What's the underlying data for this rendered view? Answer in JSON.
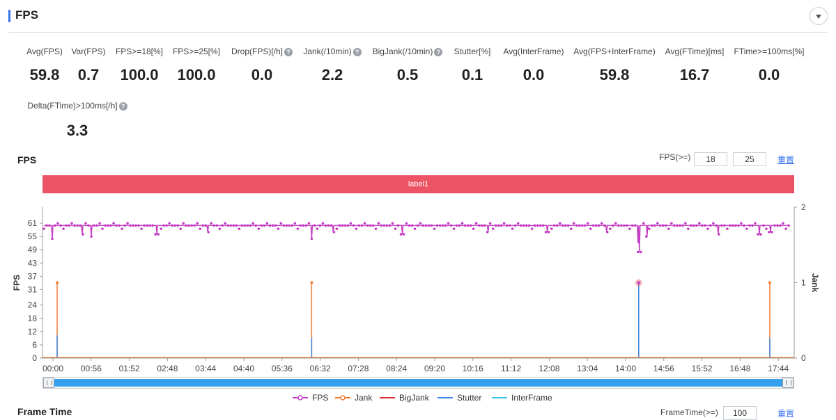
{
  "header": {
    "title": "FPS"
  },
  "metrics": [
    {
      "label": "Avg(FPS)",
      "value": "59.8",
      "help": false
    },
    {
      "label": "Var(FPS)",
      "value": "0.7",
      "help": false
    },
    {
      "label": "FPS>=18[%]",
      "value": "100.0",
      "help": false
    },
    {
      "label": "FPS>=25[%]",
      "value": "100.0",
      "help": false
    },
    {
      "label": "Drop(FPS)[/h]",
      "value": "0.0",
      "help": true
    },
    {
      "label": "Jank(/10min)",
      "value": "2.2",
      "help": true
    },
    {
      "label": "BigJank(/10min)",
      "value": "0.5",
      "help": true
    },
    {
      "label": "Stutter[%]",
      "value": "0.1",
      "help": false
    },
    {
      "label": "Avg(InterFrame)",
      "value": "0.0",
      "help": false
    },
    {
      "label": "Avg(FPS+InterFrame)",
      "value": "59.8",
      "help": false
    },
    {
      "label": "Avg(FTime)[ms]",
      "value": "16.7",
      "help": false
    },
    {
      "label": "FTime>=100ms[%]",
      "value": "0.0",
      "help": false
    },
    {
      "label": "Delta(FTime)>100ms[/h]",
      "value": "3.3",
      "help": true
    }
  ],
  "help_glyph": "?",
  "fps_section": {
    "title": "FPS",
    "threshold_label": "FPS(>=)",
    "threshold_low": "18",
    "threshold_high": "25",
    "reset_label": "重置",
    "label_bar": "label1"
  },
  "chart_data": {
    "type": "line",
    "x_ticks": [
      "00:00",
      "00:56",
      "01:52",
      "02:48",
      "03:44",
      "04:40",
      "05:36",
      "06:32",
      "07:28",
      "08:24",
      "09:20",
      "10:16",
      "11:12",
      "12:08",
      "13:04",
      "14:00",
      "14:56",
      "15:52",
      "16:48",
      "17:44"
    ],
    "ylabel": "FPS",
    "y_ticks": [
      0,
      6,
      12,
      18,
      24,
      31,
      37,
      43,
      49,
      55,
      61
    ],
    "ylim": [
      0,
      67
    ],
    "y2label": "Jank",
    "y2_ticks": [
      0,
      1,
      2
    ],
    "y2lim": [
      0,
      2
    ],
    "xlim_min": [
      0,
      1100
    ],
    "series": [
      {
        "name": "FPS",
        "color": "#c53ec4",
        "baseline": 60,
        "dips": [
          [
            1.2,
            54
          ],
          [
            5.5,
            56
          ],
          [
            6.8,
            55
          ],
          [
            16.2,
            56
          ],
          [
            23.5,
            57
          ],
          [
            38.4,
            54
          ],
          [
            41.5,
            57
          ],
          [
            51.4,
            56
          ],
          [
            63.7,
            57
          ],
          [
            72.2,
            57
          ],
          [
            80.7,
            57
          ],
          [
            85.2,
            52
          ],
          [
            85.4,
            48
          ],
          [
            86.5,
            55
          ],
          [
            96.7,
            56
          ],
          [
            102.6,
            56
          ],
          [
            104.2,
            57
          ]
        ]
      },
      {
        "name": "Jank",
        "color": "#f07c33",
        "spikes": [
          [
            1.9,
            1
          ],
          [
            38.4,
            1
          ],
          [
            85.3,
            1
          ],
          [
            104.1,
            1
          ]
        ]
      },
      {
        "name": "BigJank",
        "color": "#e52e2e",
        "spikes": []
      },
      {
        "name": "Stutter",
        "color": "#3a88e8",
        "spikes": [
          [
            1.9,
            0.3
          ],
          [
            38.4,
            0.27
          ],
          [
            85.3,
            1
          ],
          [
            104.1,
            0.27
          ]
        ]
      },
      {
        "name": "InterFrame",
        "color": "#36c2e8",
        "spikes": []
      }
    ],
    "highlight": {
      "x": 85.3,
      "y2": 1
    },
    "legend_position": "bottom"
  },
  "slider": {
    "start": 0,
    "end": 1
  },
  "next_section": {
    "title": "Frame Time",
    "threshold_label": "FrameTime(>=)",
    "threshold": "100",
    "reset_label": "重置"
  }
}
